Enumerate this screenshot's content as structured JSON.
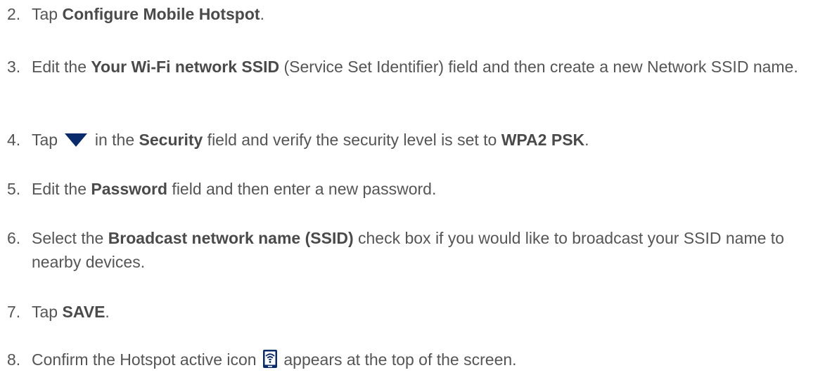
{
  "steps": [
    {
      "num": "2.",
      "parts": [
        "Tap ",
        "Configure Mobile Hotspot",
        "."
      ]
    },
    {
      "num": "3.",
      "parts": [
        "Edit the ",
        "Your Wi-Fi network SSID",
        " (Service Set Identifier) field and then create a new Network SSID name."
      ]
    },
    {
      "num": "4.",
      "parts": [
        "Tap ",
        " in the ",
        "Security",
        " field and verify the security level is set to ",
        "WPA2 PSK",
        "."
      ]
    },
    {
      "num": "5.",
      "parts": [
        "Edit the ",
        "Password",
        " field and then enter a new password."
      ]
    },
    {
      "num": "6.",
      "parts": [
        "Select the ",
        "Broadcast network name (SSID)",
        " check box if you would like to broadcast your SSID name to nearby devices."
      ]
    },
    {
      "num": "7.",
      "parts": [
        "Tap ",
        "SAVE",
        "."
      ]
    },
    {
      "num": "8.",
      "parts": [
        "Confirm the Hotspot active icon ",
        " appears at the top of the screen."
      ]
    }
  ],
  "icons": {
    "dropdown": "dropdown-triangle-icon",
    "hotspot": "hotspot-active-icon"
  },
  "colors": {
    "text": "#555555",
    "icon": "#0a2b6b"
  }
}
